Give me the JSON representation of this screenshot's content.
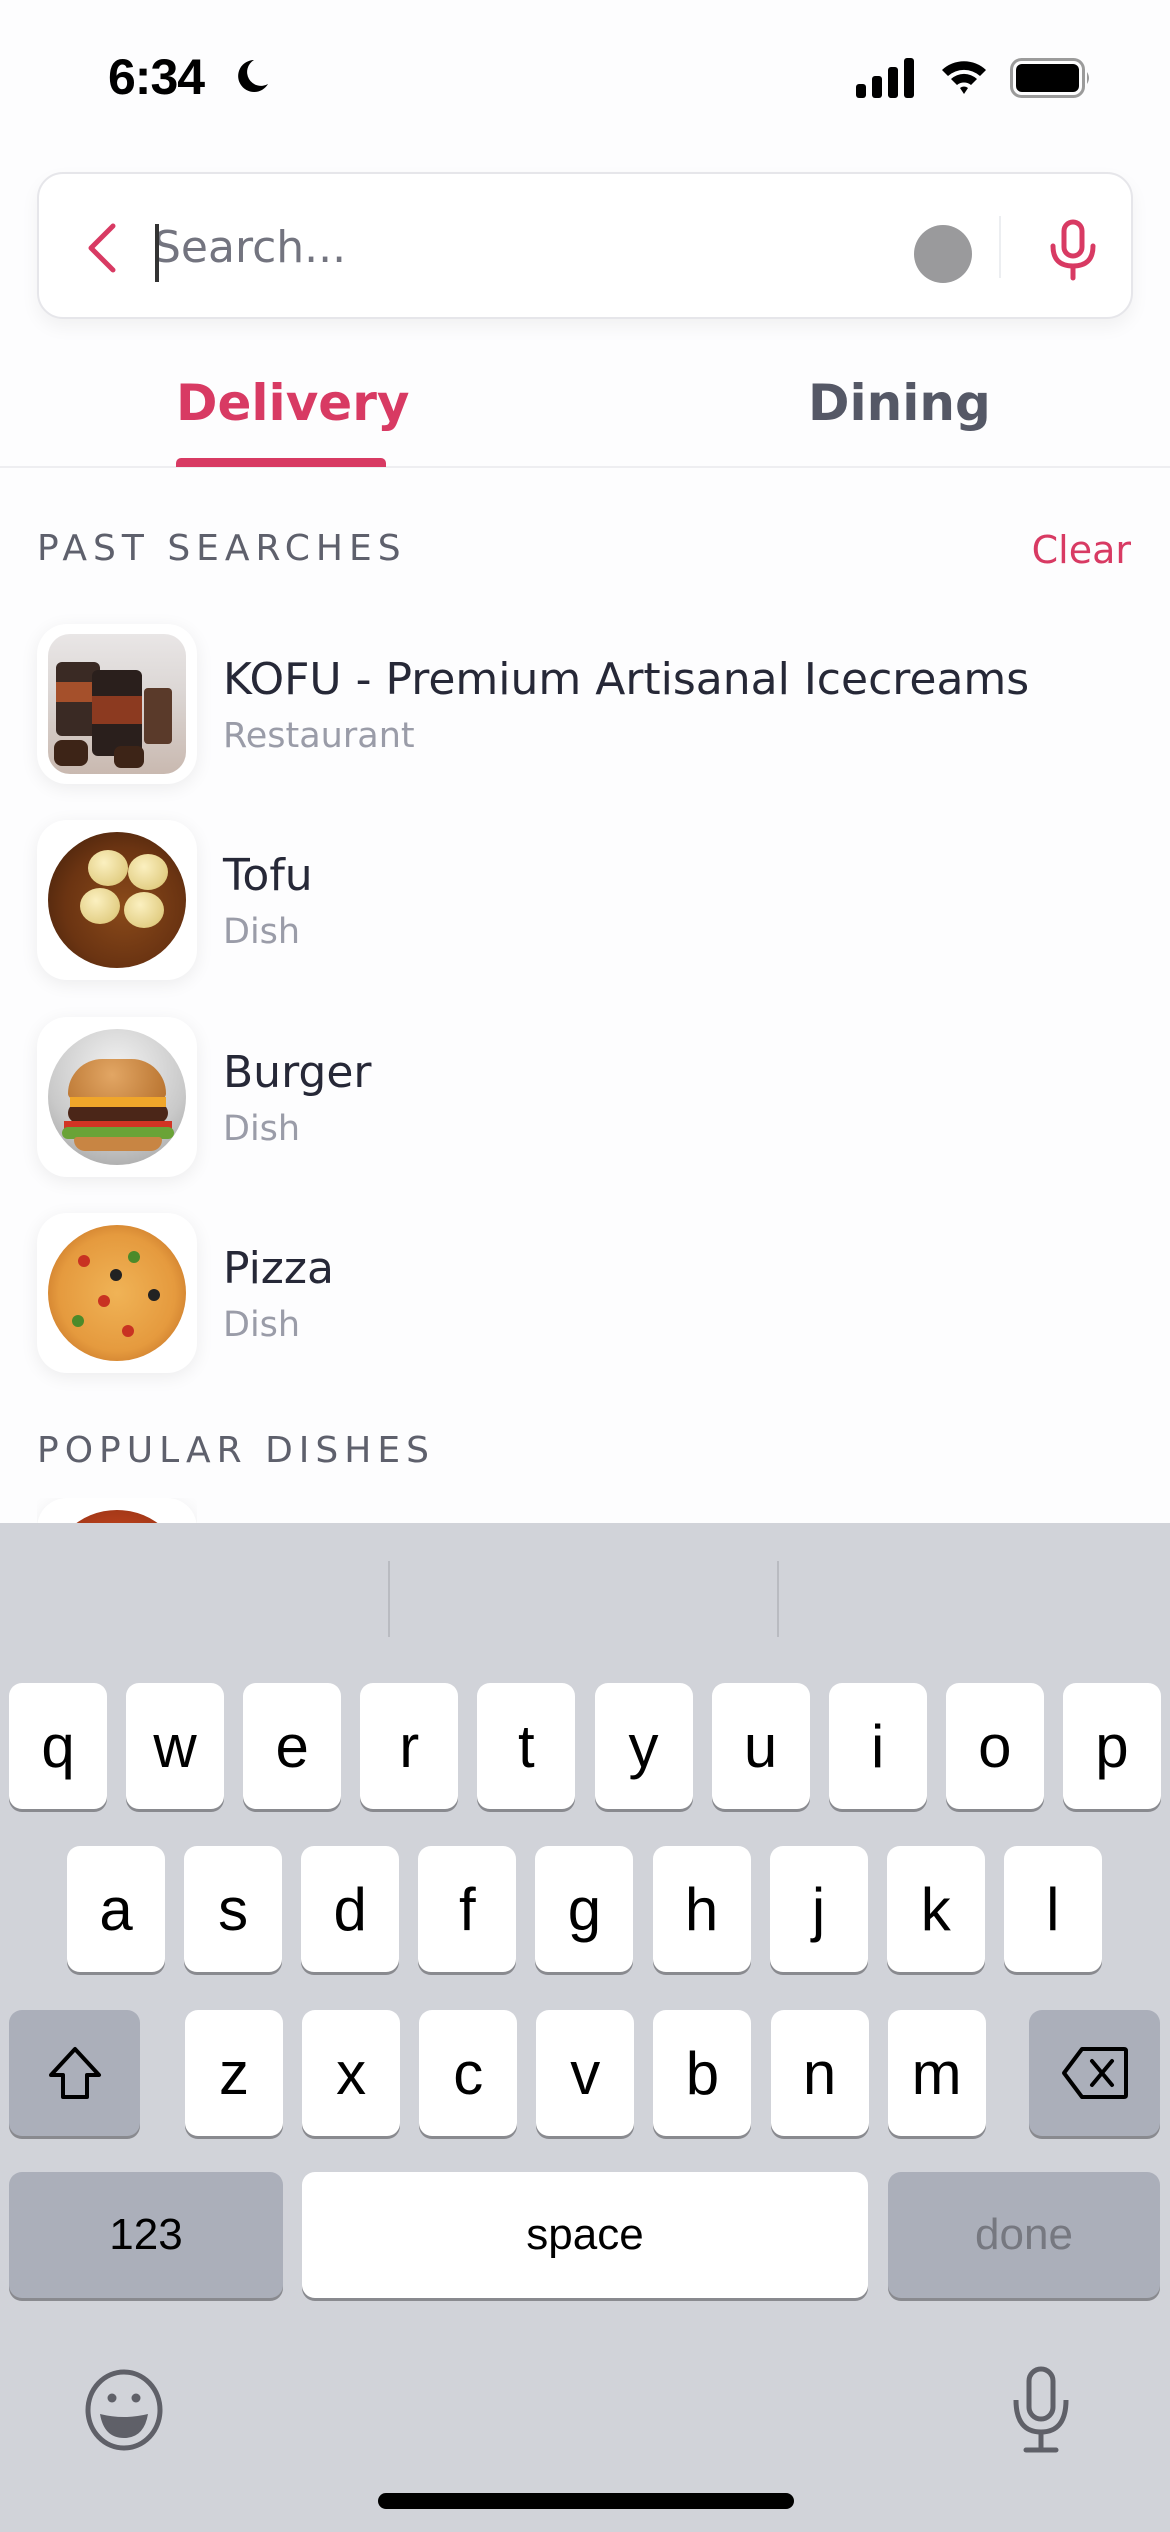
{
  "status_bar": {
    "time": "6:34",
    "focus_icon": "moon-icon",
    "signal_icon": "cellular-signal-icon",
    "wifi_icon": "wifi-icon",
    "battery_icon": "battery-icon"
  },
  "search": {
    "placeholder": "Search...",
    "value": "",
    "back_icon": "chevron-left-icon",
    "voice_icon": "microphone-icon"
  },
  "tabs": [
    {
      "label": "Delivery",
      "active": true
    },
    {
      "label": "Dining",
      "active": false
    }
  ],
  "past_searches": {
    "title": "PAST SEARCHES",
    "clear_label": "Clear",
    "items": [
      {
        "title": "KOFU - Premium Artisanal Icecreams",
        "subtitle": "Restaurant"
      },
      {
        "title": "Tofu",
        "subtitle": "Dish"
      },
      {
        "title": "Burger",
        "subtitle": "Dish"
      },
      {
        "title": "Pizza",
        "subtitle": "Dish"
      }
    ]
  },
  "popular_dishes": {
    "title": "POPULAR DISHES"
  },
  "keyboard": {
    "row1": [
      "q",
      "w",
      "e",
      "r",
      "t",
      "y",
      "u",
      "i",
      "o",
      "p"
    ],
    "row2": [
      "a",
      "s",
      "d",
      "f",
      "g",
      "h",
      "j",
      "k",
      "l"
    ],
    "row3": [
      "z",
      "x",
      "c",
      "v",
      "b",
      "n",
      "m"
    ],
    "numbers_label": "123",
    "space_label": "space",
    "done_label": "done",
    "shift_icon": "shift-icon",
    "delete_icon": "delete-backspace-icon",
    "emoji_icon": "emoji-icon",
    "dictation_icon": "microphone-icon"
  },
  "colors": {
    "accent": "#d83a63",
    "text_primary": "#262837",
    "text_secondary": "#9a9ca8",
    "section_title": "#5e606c",
    "keyboard_bg": "#d1d3d9"
  }
}
